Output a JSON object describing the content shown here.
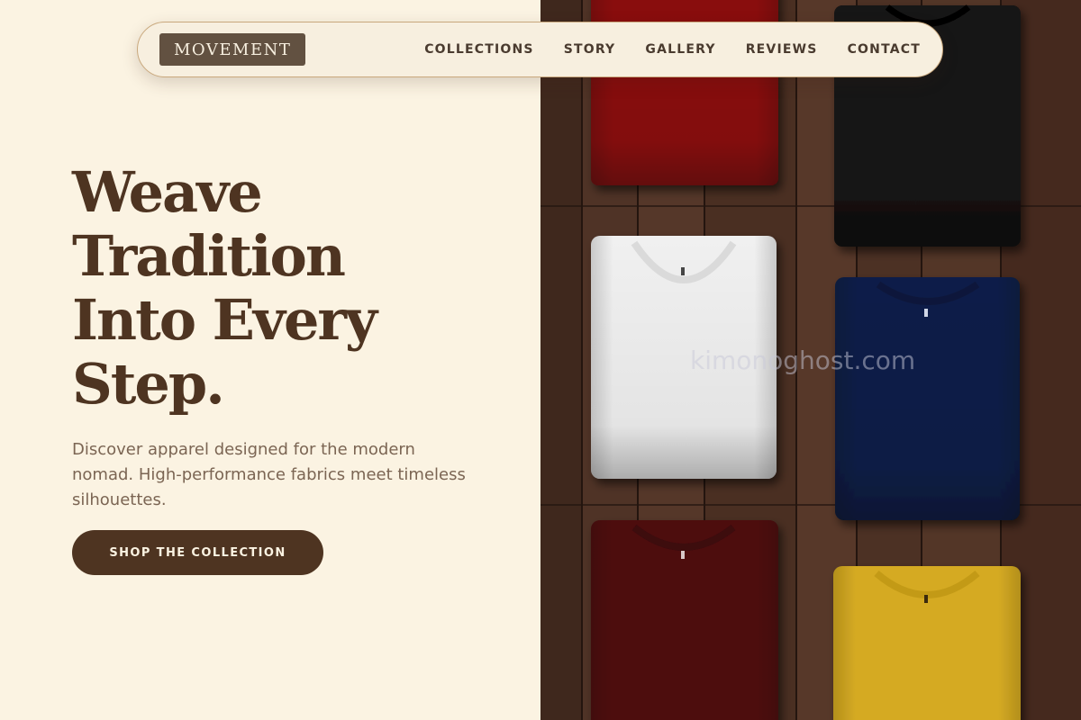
{
  "nav": {
    "brand": "MOVEMENT",
    "links": [
      "COLLECTIONS",
      "STORY",
      "GALLERY",
      "REVIEWS",
      "CONTACT"
    ]
  },
  "hero": {
    "title_lines": [
      "Weave",
      "Tradition",
      "Into Every",
      "Step."
    ],
    "subtitle": "Discover apparel designed for the modern nomad. High-performance fabrics meet timeless silhouettes.",
    "cta": "SHOP THE COLLECTION"
  },
  "image": {
    "watermark": "kimonoghost.com",
    "shirt_colors": {
      "red": "#8a0c0f",
      "black": "#141313",
      "white": "#f0f0f0",
      "navy": "#0b1f48",
      "maroon": "#4e0a0c",
      "yellow": "#d5aa22"
    }
  },
  "colors": {
    "background": "#fbf3e2",
    "brand_dark": "#4e3421",
    "wood": "#4b3023"
  }
}
